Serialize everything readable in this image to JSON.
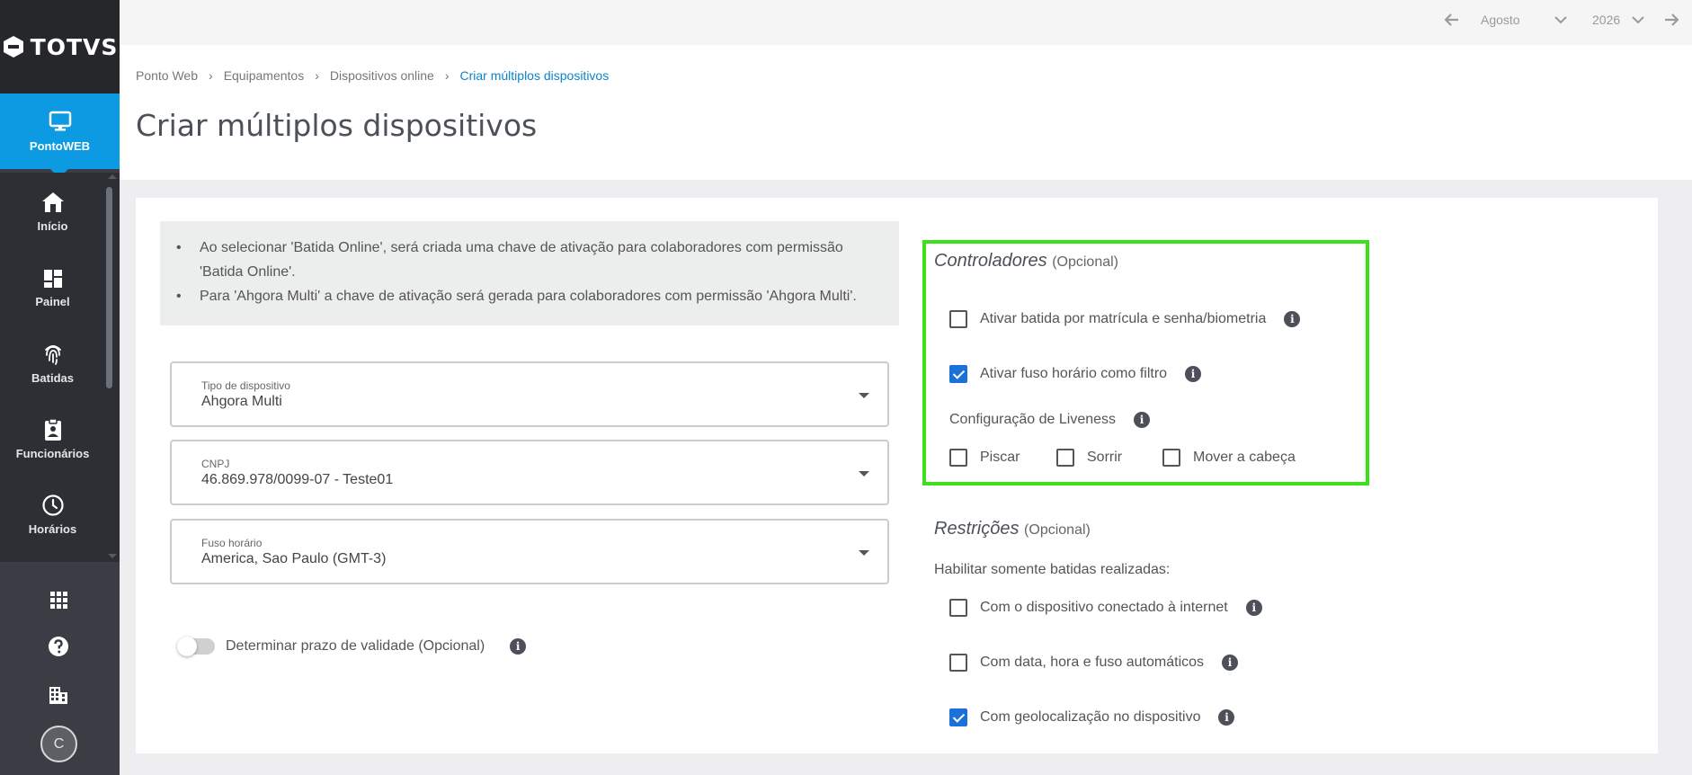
{
  "sidebar": {
    "logo": "TOTVS",
    "app": {
      "label": "PontoWEB",
      "icon": "monitor-icon"
    },
    "items": [
      {
        "label": "Início",
        "icon": "home-icon"
      },
      {
        "label": "Painel",
        "icon": "dashboard-icon"
      },
      {
        "label": "Batidas",
        "icon": "fingerprint-icon"
      },
      {
        "label": "Funcionários",
        "icon": "badge-icon"
      },
      {
        "label": "Horários",
        "icon": "clock-icon"
      }
    ],
    "bottom_icons": [
      "apps-grid-icon",
      "help-icon",
      "building-icon"
    ],
    "avatar_initial": "C"
  },
  "topbar": {
    "month": "Agosto",
    "year": "2026"
  },
  "breadcrumb": [
    "Ponto Web",
    "Equipamentos",
    "Dispositivos online",
    "Criar múltiplos dispositivos"
  ],
  "page_title": "Criar múltiplos dispositivos",
  "info": [
    "Ao selecionar 'Batida Online', será criada uma chave de ativação para colaboradores com permissão 'Batida Online'.",
    "Para 'Ahgora Multi' a chave de ativação será gerada para colaboradores com permissão 'Ahgora Multi'."
  ],
  "fields": {
    "tipo": {
      "label": "Tipo de dispositivo",
      "value": "Ahgora Multi"
    },
    "cnpj": {
      "label": "CNPJ",
      "value": "46.869.978/0099-07 - Teste01"
    },
    "fuso": {
      "label": "Fuso horário",
      "value": "America, Sao Paulo (GMT-3)"
    }
  },
  "validade": {
    "label": "Determinar prazo de validade (Opcional)",
    "enabled": false
  },
  "controladores": {
    "title": "Controladores",
    "optional": "(Opcional)",
    "ativar_batida": {
      "label": "Ativar batida por matrícula e senha/biometria",
      "checked": false
    },
    "ativar_fuso": {
      "label": "Ativar fuso horário como filtro",
      "checked": true
    },
    "liveness_label": "Configuração de Liveness",
    "piscar": {
      "label": "Piscar",
      "checked": false
    },
    "sorrir": {
      "label": "Sorrir",
      "checked": false
    },
    "mover": {
      "label": "Mover a cabeça",
      "checked": false
    }
  },
  "restricoes": {
    "title": "Restrições",
    "optional": "(Opcional)",
    "subtitle": "Habilitar somente batidas realizadas:",
    "internet": {
      "label": "Com o dispositivo conectado à internet",
      "checked": false
    },
    "data_hora": {
      "label": "Com data, hora e fuso automáticos",
      "checked": false
    },
    "geo": {
      "label": "Com geolocalização no dispositivo",
      "checked": true
    }
  },
  "colors": {
    "accent": "#0c9be2",
    "highlight_border": "#3be11c",
    "checkbox_checked": "#1a72d9"
  }
}
